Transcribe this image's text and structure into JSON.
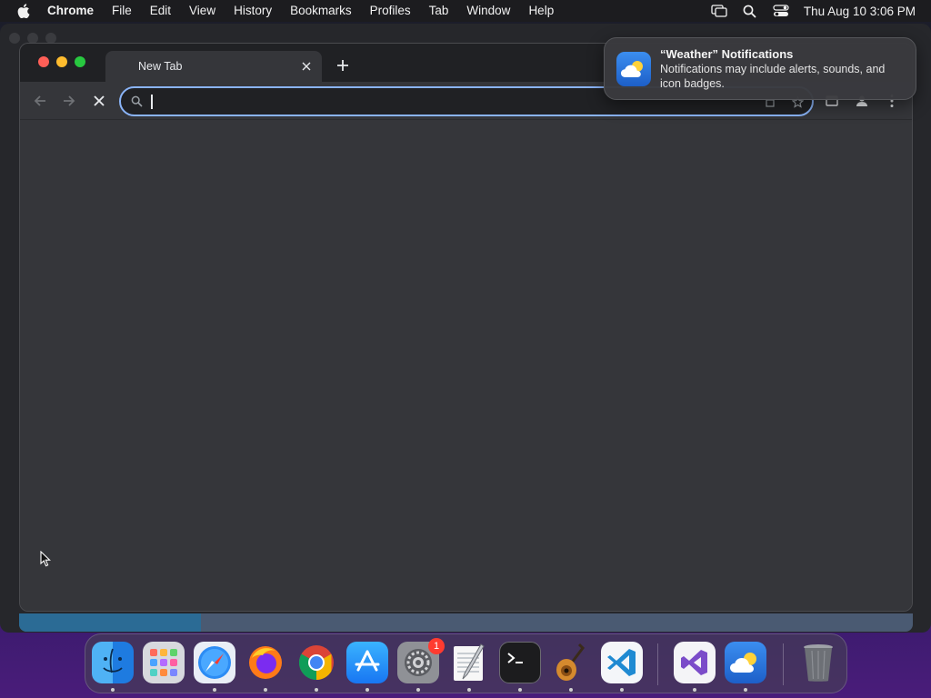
{
  "menubar": {
    "app_name": "Chrome",
    "items": [
      "File",
      "Edit",
      "View",
      "History",
      "Bookmarks",
      "Profiles",
      "Tab",
      "Window",
      "Help"
    ],
    "clock": "Thu Aug 10  3:06 PM"
  },
  "browser": {
    "tab_title": "New Tab",
    "address_value": "",
    "address_placeholder": ""
  },
  "notification": {
    "title": "“Weather” Notifications",
    "body": "Notifications may include alerts, sounds, and icon badges."
  },
  "dock": {
    "apps": [
      "finder",
      "launchpad",
      "safari",
      "firefox",
      "chrome",
      "app-store",
      "system-settings",
      "textedit",
      "terminal",
      "garageband",
      "vscode",
      "visual-studio",
      "weather",
      "trash"
    ],
    "settings_badge": "1"
  },
  "colors": {
    "accent": "#8ab4f8",
    "window_bg": "#35363a",
    "tabstrip_bg": "#202124"
  }
}
